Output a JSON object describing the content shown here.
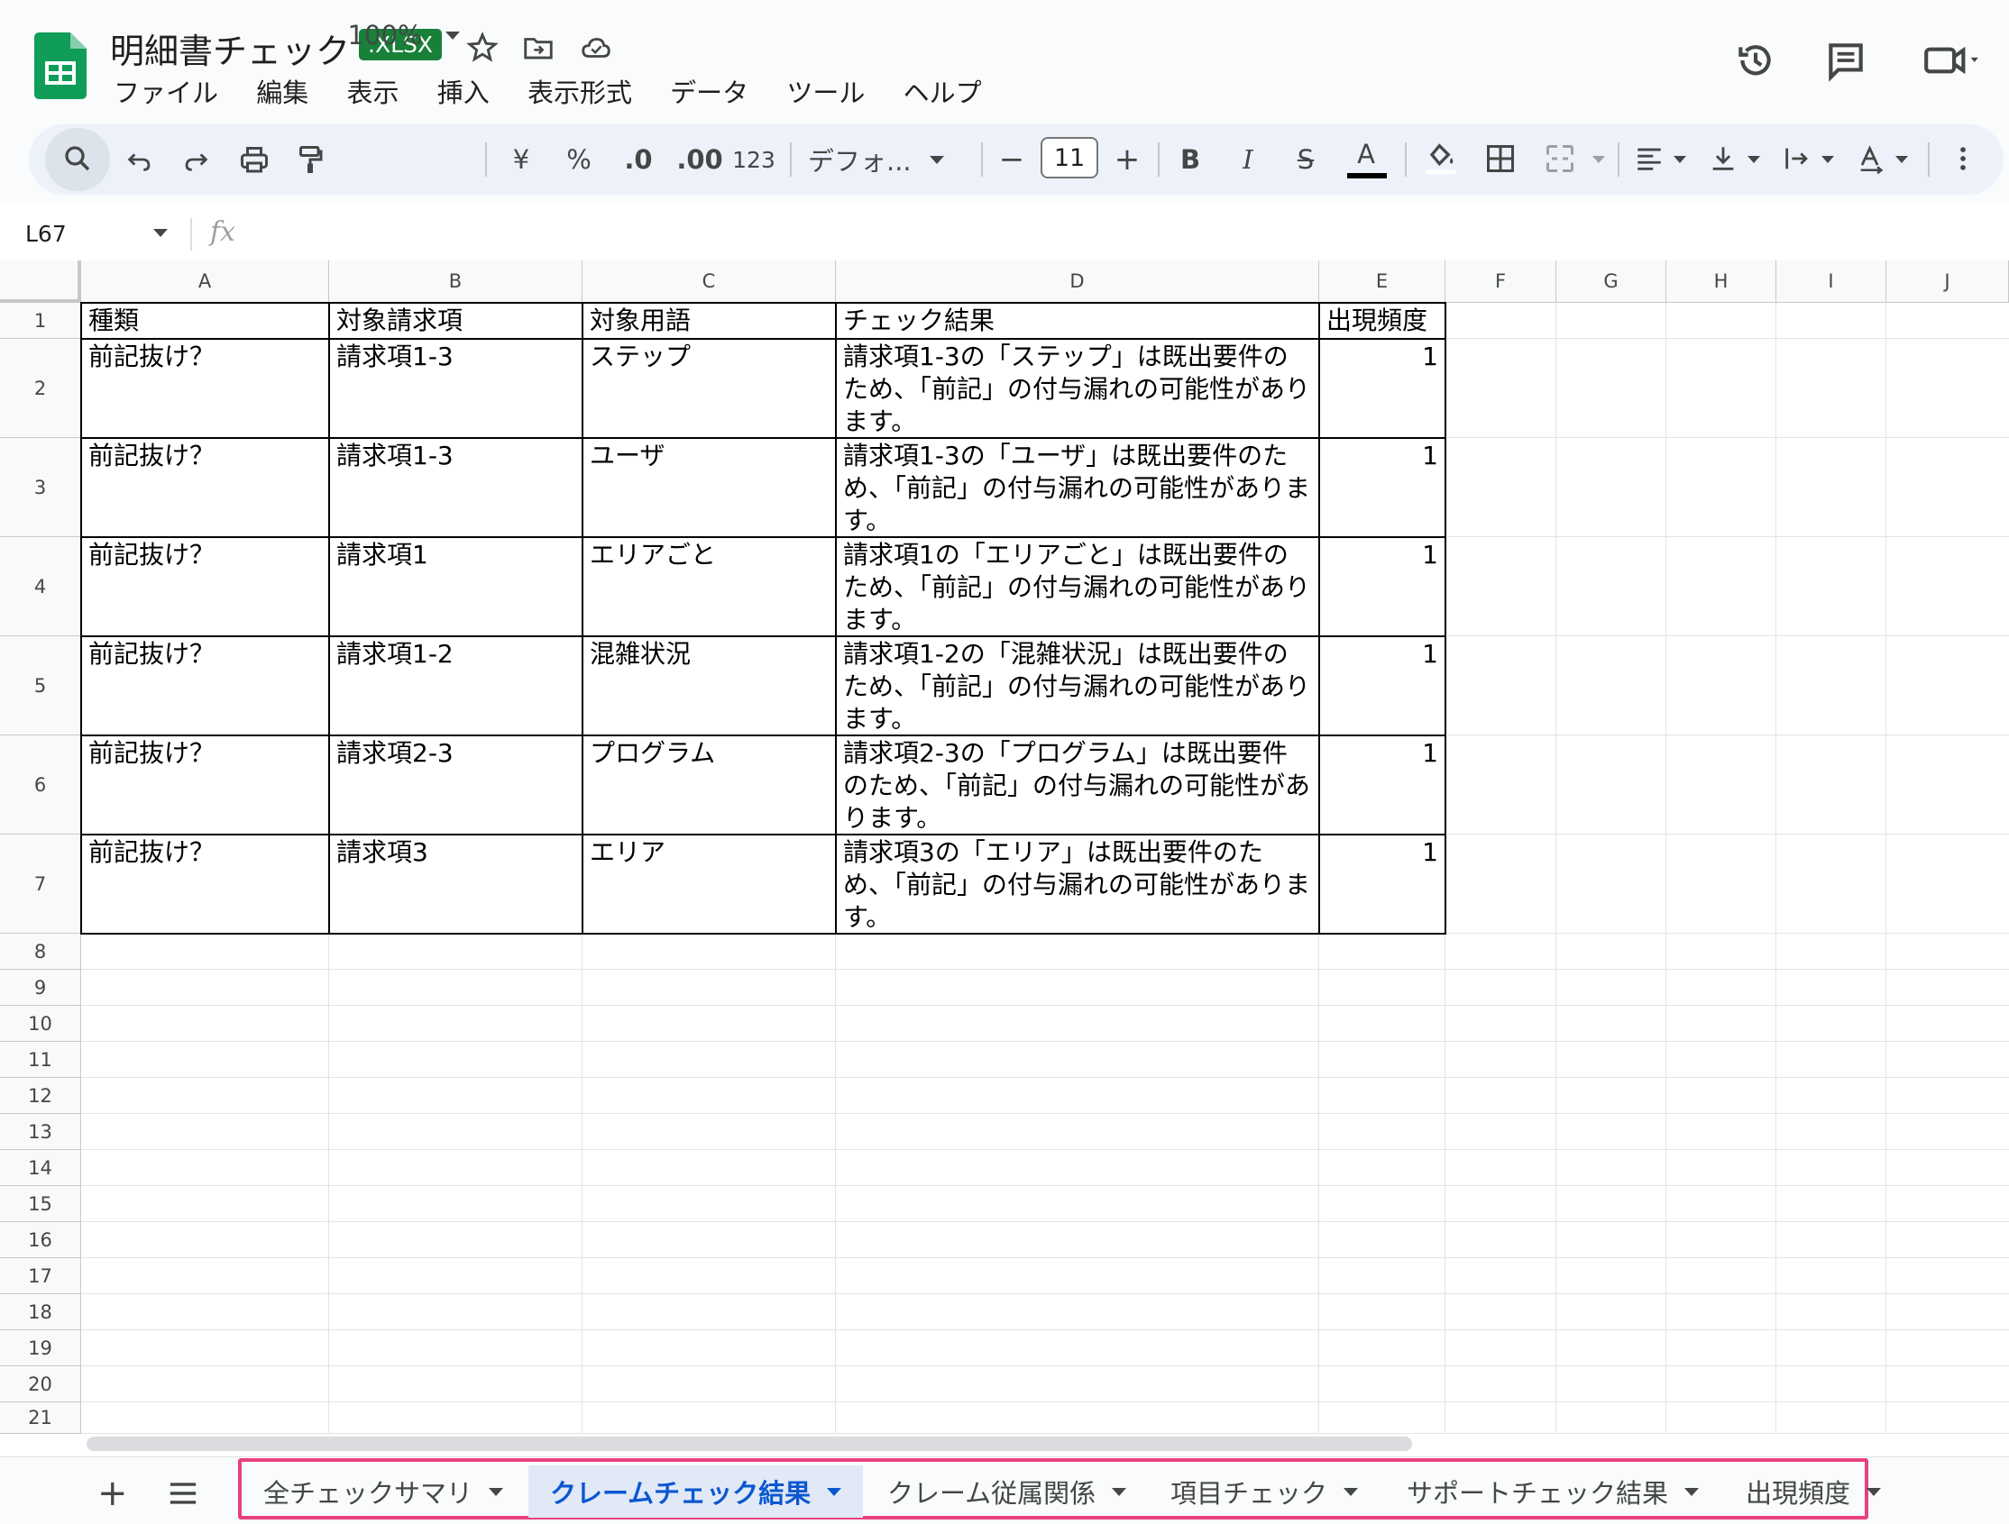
{
  "app": {
    "title": "明細書チェック",
    "badge": ".XLSX",
    "menu": [
      "ファイル",
      "編集",
      "表示",
      "挿入",
      "表示形式",
      "データ",
      "ツール",
      "ヘルプ"
    ]
  },
  "toolbar": {
    "zoom": "100%",
    "currency": "¥",
    "percent": "%",
    "dec_decrease": ".0",
    "dec_increase": ".00",
    "number_format": "123",
    "font": "デフォ...",
    "minus": "−",
    "font_size": "11",
    "plus": "+",
    "bold": "B",
    "italic": "I",
    "strike": "S",
    "text_color": "A"
  },
  "formula_bar": {
    "cell_ref": "L67",
    "fx": "fx"
  },
  "columns": [
    "A",
    "B",
    "C",
    "D",
    "E",
    "F",
    "G",
    "H",
    "I",
    "J"
  ],
  "rows": [
    "1",
    "2",
    "3",
    "4",
    "5",
    "6",
    "7",
    "8",
    "9",
    "10",
    "11",
    "12",
    "13",
    "14",
    "15",
    "16",
    "17",
    "18",
    "19",
    "20",
    "21"
  ],
  "table": {
    "headers": [
      "種類",
      "対象請求項",
      "対象用語",
      "チェック結果",
      "出現頻度"
    ],
    "rows": [
      [
        "前記抜け？",
        "請求項1-3",
        "ステップ",
        "請求項1-3の「ステップ」は既出要件のため、「前記」の付与漏れの可能性があります。",
        "1"
      ],
      [
        "前記抜け？",
        "請求項1-3",
        "ユーザ",
        "請求項1-3の「ユーザ」は既出要件のため、「前記」の付与漏れの可能性があります。",
        "1"
      ],
      [
        "前記抜け？",
        "請求項1",
        "エリアごと",
        "請求項1の「エリアごと」は既出要件のため、「前記」の付与漏れの可能性があります。",
        "1"
      ],
      [
        "前記抜け？",
        "請求項1-2",
        "混雑状況",
        "請求項1-2の「混雑状況」は既出要件のため、「前記」の付与漏れの可能性があります。",
        "1"
      ],
      [
        "前記抜け？",
        "請求項2-3",
        "プログラム",
        "請求項2-3の「プログラム」は既出要件のため、「前記」の付与漏れの可能性があります。",
        "1"
      ],
      [
        "前記抜け？",
        "請求項3",
        "エリア",
        "請求項3の「エリア」は既出要件のため、「前記」の付与漏れの可能性があります。",
        "1"
      ]
    ]
  },
  "sheets": [
    "全チェックサマリ",
    "クレームチェック結果",
    "クレーム従属関係",
    "項目チェック",
    "サポートチェック結果",
    "出現頻度"
  ],
  "active_sheet": "クレームチェック結果",
  "bottom": {
    "add": "+",
    "all_sheets": "≡"
  },
  "colors": {
    "accent": "#0b57d0",
    "sheets_green": "#188038",
    "highlight": "#e8417f"
  }
}
